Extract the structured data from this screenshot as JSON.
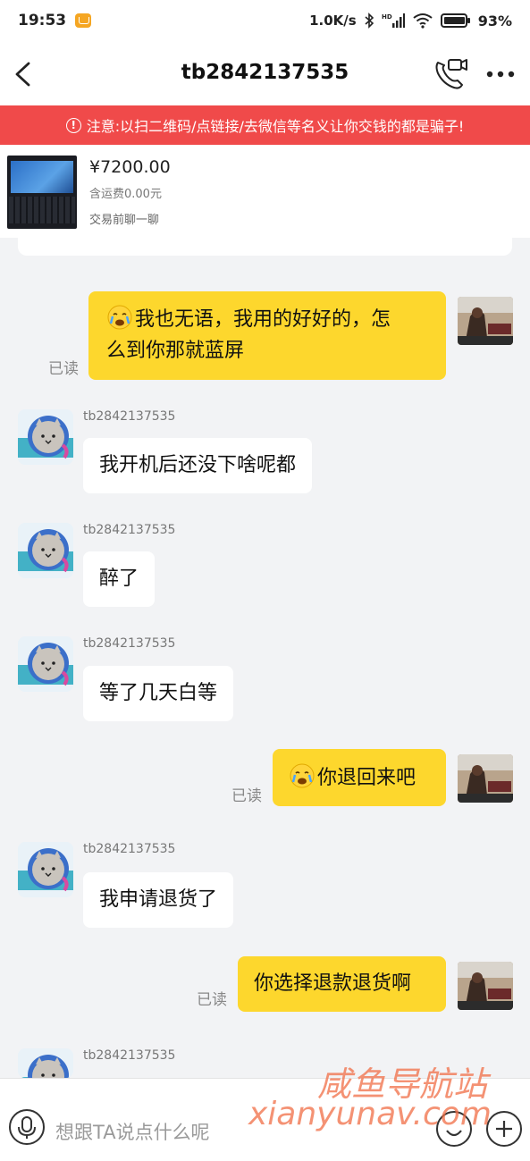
{
  "status_bar": {
    "time": "19:53",
    "network_speed": "1.0K/s",
    "hd_label": "HD",
    "battery": "93%"
  },
  "header": {
    "title": "tb2842137535"
  },
  "warning": {
    "text": "注意:以扫二维码/点链接/去微信等名义让你交钱的都是骗子!"
  },
  "product": {
    "price": "¥7200.00",
    "shipping": "含运费0.00元",
    "chat_first": "交易前聊一聊"
  },
  "messages": [
    {
      "from": "me",
      "text": "我也无语，我用的好好的，怎么到你那就蓝屏",
      "has_emoji": true,
      "status": "已读"
    },
    {
      "from": "other",
      "sender": "tb2842137535",
      "text": "我开机后还没下啥呢都"
    },
    {
      "from": "other",
      "sender": "tb2842137535",
      "text": "醉了"
    },
    {
      "from": "other",
      "sender": "tb2842137535",
      "text": "等了几天白等"
    },
    {
      "from": "me",
      "text": "你退回来吧",
      "has_emoji": true,
      "status": "已读"
    },
    {
      "from": "other",
      "sender": "tb2842137535",
      "text": "我申请退货了"
    },
    {
      "from": "me",
      "text": "你选择退款退货啊",
      "has_emoji": false,
      "status": "已读"
    },
    {
      "from": "other",
      "sender": "tb2842137535",
      "text": ""
    }
  ],
  "message_line1": "我也无语，我用的好好的，怎",
  "message_line2": "么到你那就蓝屏",
  "input": {
    "placeholder": "想跟TA说点什么呢"
  },
  "watermark": {
    "cn": "咸鱼导航站",
    "url": "xianyunav.com"
  },
  "colors": {
    "warning_bg": "#f04a4a",
    "my_bubble": "#fdd72d",
    "their_bubble": "#ffffff",
    "page_bg": "#f2f3f5"
  }
}
